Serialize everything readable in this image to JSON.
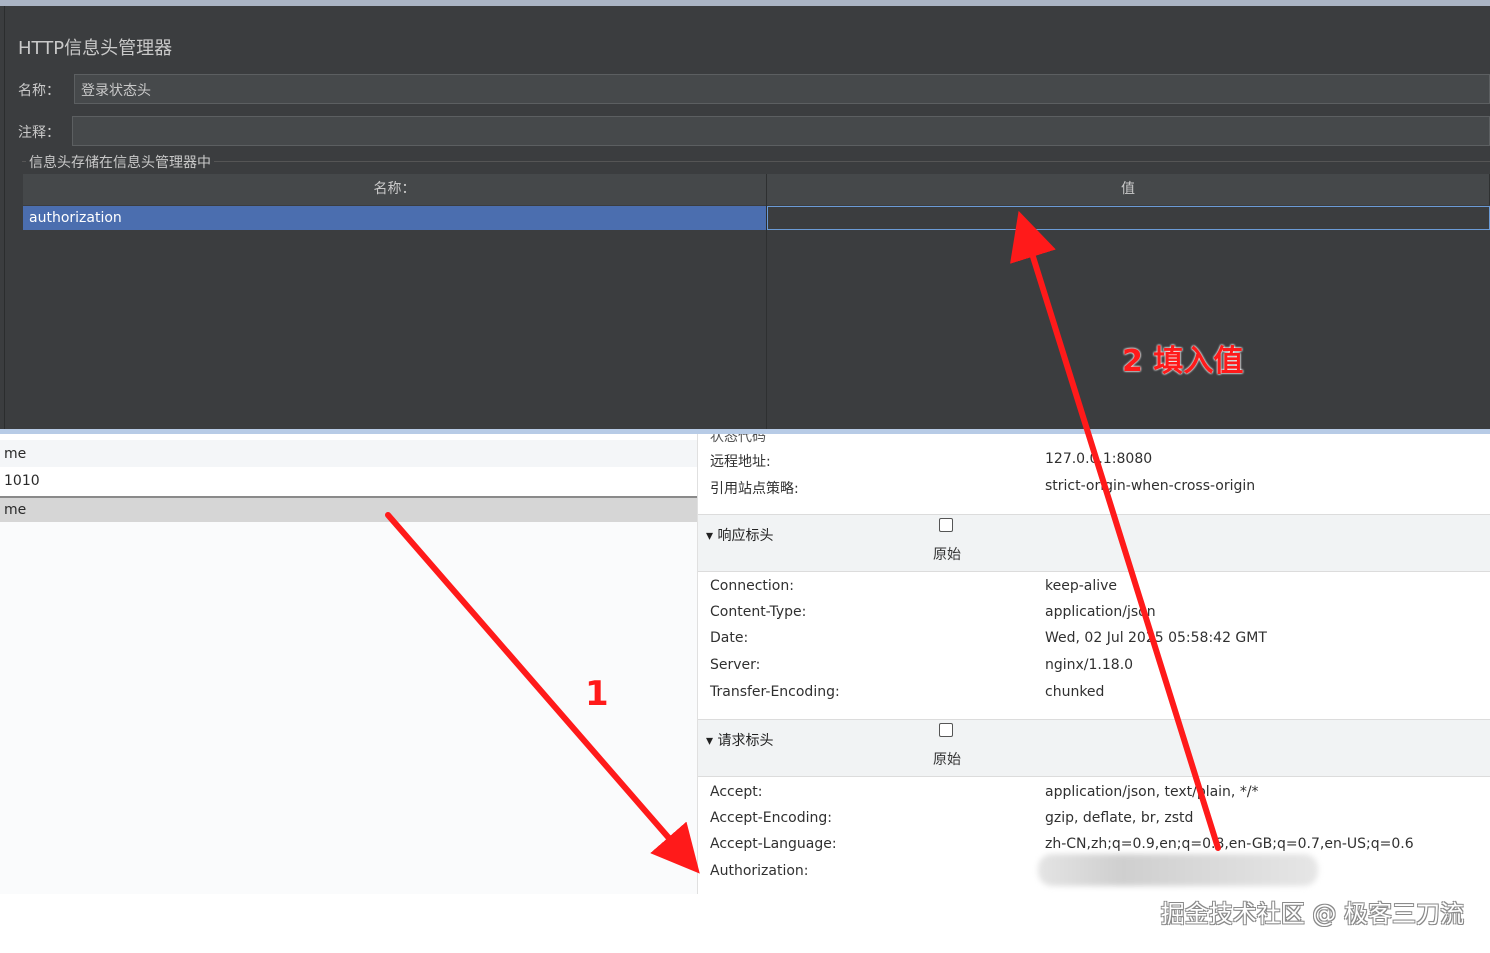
{
  "jmeter": {
    "title": "HTTP信息头管理器",
    "name_label": "名称：",
    "name_value": "登录状态头",
    "comment_label": "注释：",
    "comment_value": "",
    "group_title": "信息头存储在信息头管理器中",
    "table": {
      "columns": [
        "名称：",
        "值"
      ],
      "rows": [
        {
          "name": "authorization",
          "value": ""
        }
      ]
    }
  },
  "left_list": [
    "me",
    "1010",
    "me"
  ],
  "devtools": {
    "general": [
      {
        "key": "远程地址:",
        "value": "127.0.0.1:8080"
      },
      {
        "key": "引用站点策略:",
        "value": "strict-origin-when-cross-origin"
      }
    ],
    "response_section": {
      "title": "▾ 响应标头",
      "raw_label": "原始"
    },
    "response_headers": [
      {
        "key": "Connection:",
        "value": "keep-alive"
      },
      {
        "key": "Content-Type:",
        "value": "application/json"
      },
      {
        "key": "Date:",
        "value": "Wed, 02 Jul 2025 05:58:42 GMT"
      },
      {
        "key": "Server:",
        "value": "nginx/1.18.0"
      },
      {
        "key": "Transfer-Encoding:",
        "value": "chunked"
      }
    ],
    "request_section": {
      "title": "▾ 请求标头",
      "raw_label": "原始"
    },
    "request_headers": [
      {
        "key": "Accept:",
        "value": "application/json, text/plain, */*"
      },
      {
        "key": "Accept-Encoding:",
        "value": "gzip, deflate, br, zstd"
      },
      {
        "key": "Accept-Language:",
        "value": "zh-CN,zh;q=0.9,en;q=0.8,en-GB;q=0.7,en-US;q=0.6"
      },
      {
        "key": "Authorization:",
        "value": ""
      }
    ]
  },
  "annotations": {
    "step1": "1",
    "step2": "2 填入值",
    "color": "#ff1a1a"
  },
  "watermark": "掘金技术社区 @ 极客三刀流"
}
